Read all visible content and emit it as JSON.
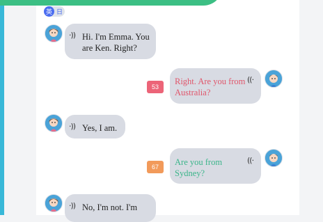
{
  "lang_toggle": {
    "active": "英",
    "inactive": "日"
  },
  "messages": [
    {
      "speaker": "Emma",
      "text_line1": "Hi. I'm Emma. You",
      "text_line2": "are Ken. Right?"
    },
    {
      "speaker": "Ken",
      "text_line1": "Right. Are you from",
      "text_line2": "Australia?",
      "score": "53",
      "score_color": "#ec6478",
      "text_color": "#e0566b"
    },
    {
      "speaker": "Emma",
      "text_line1": "Yes, I am."
    },
    {
      "speaker": "Ken",
      "text_line1": "Are you from",
      "text_line2": "Sydney?",
      "score": "67",
      "score_color": "#f29a5a",
      "text_color": "#3bb58a"
    },
    {
      "speaker": "Emma",
      "text_line1": "No, I'm not. I'm"
    }
  ],
  "colors": {
    "accent_blue": "#4a6cf0",
    "banner_green": "#3cbf84",
    "bubble_gray": "#d8dbe3"
  }
}
